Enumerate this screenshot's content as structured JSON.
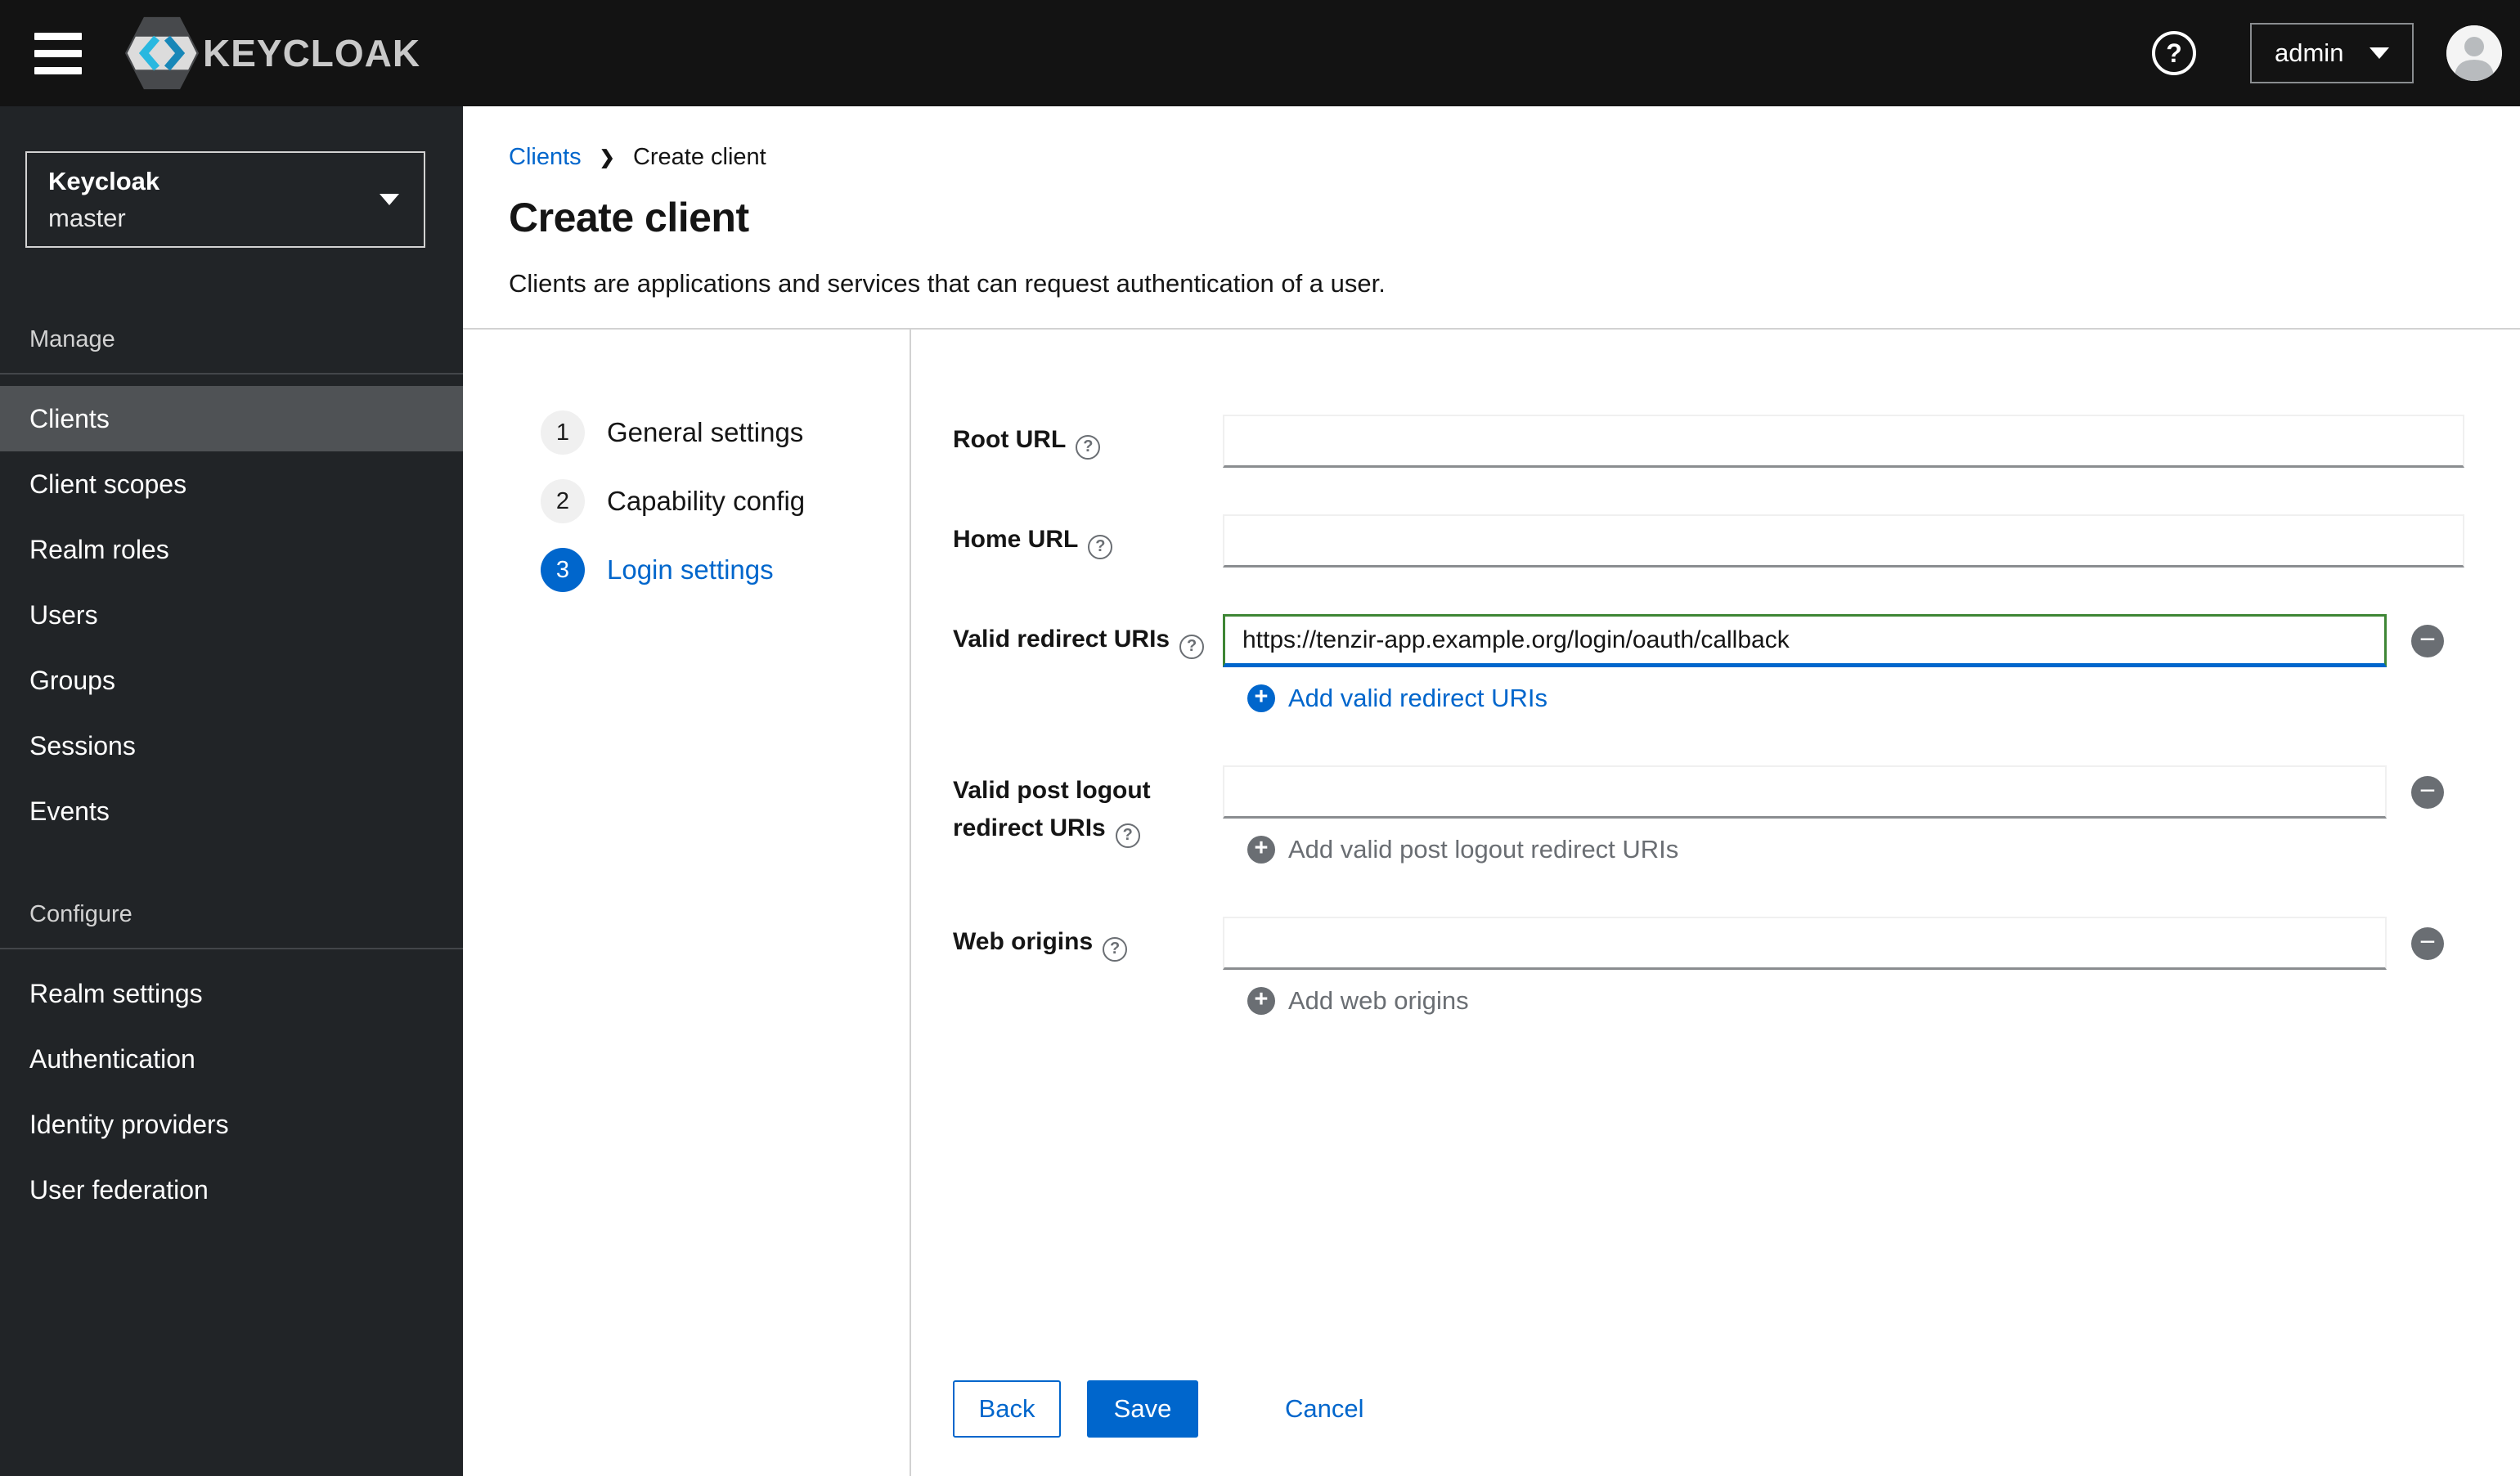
{
  "header": {
    "brand": "KEYCLOAK",
    "user_menu": {
      "label": "admin"
    }
  },
  "sidebar": {
    "realm_selector": {
      "realm": "Keycloak",
      "current": "master"
    },
    "sections": [
      {
        "label": "Manage",
        "items": [
          {
            "label": "Clients",
            "selected": true
          },
          {
            "label": "Client scopes",
            "selected": false
          },
          {
            "label": "Realm roles",
            "selected": false
          },
          {
            "label": "Users",
            "selected": false
          },
          {
            "label": "Groups",
            "selected": false
          },
          {
            "label": "Sessions",
            "selected": false
          },
          {
            "label": "Events",
            "selected": false
          }
        ]
      },
      {
        "label": "Configure",
        "items": [
          {
            "label": "Realm settings",
            "selected": false
          },
          {
            "label": "Authentication",
            "selected": false
          },
          {
            "label": "Identity providers",
            "selected": false
          },
          {
            "label": "User federation",
            "selected": false
          }
        ]
      }
    ]
  },
  "breadcrumb": {
    "items": [
      {
        "label": "Clients"
      },
      {
        "label": "Create client"
      }
    ]
  },
  "page": {
    "title": "Create client",
    "subtitle": "Clients are applications and services that can request authentication of a user."
  },
  "wizard": {
    "steps": [
      {
        "number": "1",
        "label": "General settings",
        "active": false
      },
      {
        "number": "2",
        "label": "Capability config",
        "active": false
      },
      {
        "number": "3",
        "label": "Login settings",
        "active": true
      }
    ]
  },
  "form": {
    "root_url": {
      "label": "Root URL",
      "value": ""
    },
    "home_url": {
      "label": "Home URL",
      "value": ""
    },
    "redirect_uris": {
      "label": "Valid redirect URIs",
      "value": "https://tenzir-app.example.org/login/oauth/callback",
      "add_label": "Add valid redirect URIs"
    },
    "post_logout_uris": {
      "label": "Valid post logout redirect URIs",
      "value": "",
      "add_label": "Add valid post logout redirect URIs"
    },
    "web_origins": {
      "label": "Web origins",
      "value": "",
      "add_label": "Add web origins"
    }
  },
  "actions": {
    "back": "Back",
    "save": "Save",
    "cancel": "Cancel"
  },
  "icons": {
    "help": "?",
    "plus": "+",
    "minus": "−",
    "breadcrumb_separator": "❯"
  },
  "colors": {
    "accent_blue": "#0066cc",
    "success_green": "#3e8635",
    "masthead_bg": "#131313",
    "sidebar_bg": "#212427",
    "sidebar_selected_bg": "#4f5255",
    "input_bottom_border": "#8a8d90",
    "muted_gray": "#6a6e73"
  }
}
